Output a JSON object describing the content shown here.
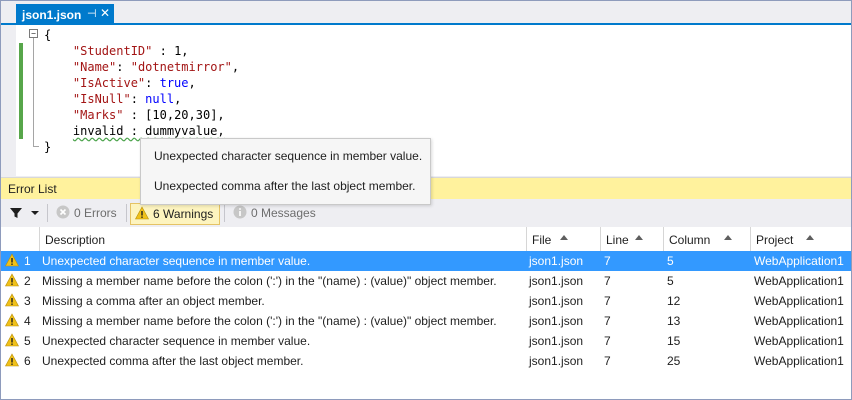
{
  "editor": {
    "tab_label": "json1.json",
    "pin_glyph": "⊣",
    "close_glyph": "✕",
    "outline_glyph": "−",
    "code": {
      "open_brace": "{",
      "close_brace": "}",
      "l1_key": "\"StudentID\"",
      "l1_sep": " : ",
      "l1_val": "1,",
      "l2_key": "\"Name\"",
      "l2_sep": ": ",
      "l2_val": "\"dotnetmirror\"",
      "l2_end": ",",
      "l3_key": "\"IsActive\"",
      "l3_sep": ": ",
      "l3_val": "true",
      "l3_end": ",",
      "l4_key": "\"IsNull\"",
      "l4_sep": ": ",
      "l4_val": "null",
      "l4_end": ",",
      "l5_key": "\"Marks\"",
      "l5_sep": " : ",
      "l5_val": "[10,20,30],",
      "l6_text": "invalid : dummyvalue,"
    }
  },
  "tooltip": {
    "line1": "Unexpected character sequence in member value.",
    "line2": "Unexpected comma after the last object member."
  },
  "error_list": {
    "title": "Error List",
    "toolbar": {
      "errors": "0 Errors",
      "warnings": "6 Warnings",
      "messages": "0 Messages"
    },
    "columns": {
      "description": "Description",
      "file": "File",
      "line": "Line",
      "column": "Column",
      "project": "Project"
    },
    "rows": [
      {
        "num": "1",
        "description": "Unexpected character sequence in member value.",
        "file": "json1.json",
        "line": "7",
        "column": "5",
        "project": "WebApplication1"
      },
      {
        "num": "2",
        "description": "Missing a member name before the colon (':') in the \"(name) : (value)\" object member.",
        "file": "json1.json",
        "line": "7",
        "column": "5",
        "project": "WebApplication1"
      },
      {
        "num": "3",
        "description": "Missing a comma after an object member.",
        "file": "json1.json",
        "line": "7",
        "column": "12",
        "project": "WebApplication1"
      },
      {
        "num": "4",
        "description": "Missing a member name before the colon (':') in the \"(name) : (value)\" object member.",
        "file": "json1.json",
        "line": "7",
        "column": "13",
        "project": "WebApplication1"
      },
      {
        "num": "5",
        "description": "Unexpected character sequence in member value.",
        "file": "json1.json",
        "line": "7",
        "column": "15",
        "project": "WebApplication1"
      },
      {
        "num": "6",
        "description": "Unexpected comma after the last object member.",
        "file": "json1.json",
        "line": "7",
        "column": "25",
        "project": "WebApplication1"
      }
    ],
    "selected_row": 0
  },
  "colors": {
    "accent": "#007acc",
    "selection": "#3399ff",
    "warning_bar": "#fff29d",
    "warning_icon": "#f0c11a",
    "error_icon": "#c7c7c7"
  },
  "icons": {
    "filter": "filter-icon",
    "dropdown": "chevron-down-icon",
    "error": "error-icon",
    "warning": "warning-icon",
    "message": "info-icon",
    "sort": "sort-ascending-icon"
  }
}
